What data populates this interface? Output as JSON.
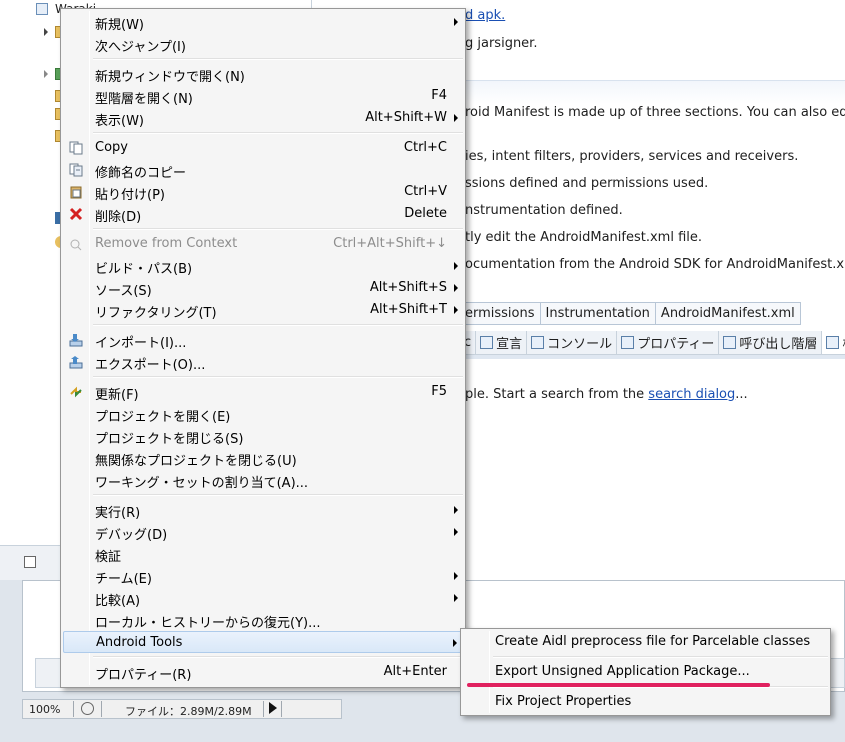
{
  "background": {
    "project_name": "Waraki",
    "editor_lines": [
      {
        "text": "d apk.",
        "link": true
      },
      {
        "text": "g jarsigner.",
        "link": false
      },
      {
        "text": "roid Manifest is made up of three sections. You can also edit the",
        "link": false
      },
      {
        "text": "ies, intent filters, providers, services and receivers.",
        "link": false
      },
      {
        "text": "ssions defined and permissions used.",
        "link": false
      },
      {
        "text": "nstrumentation defined.",
        "link": false
      },
      {
        "text": "tly edit the AndroidManifest.xml file.",
        "link": false
      },
      {
        "text": "ocumentation from the Android SDK for AndroidManifest.xml.",
        "link": false
      }
    ],
    "editor_tabs": [
      "ermissions",
      "Instrumentation",
      "AndroidManifest.xml"
    ],
    "view_tabs": [
      "c",
      "宣言",
      "コンソール",
      "プロパティー",
      "呼び出し階層",
      "検"
    ],
    "search_text": "ple. Start a search from the",
    "search_link": "search dialog",
    "search_tail": "...",
    "status": {
      "zoom": "100%",
      "memory": "ファイル：2.89M/2.89M"
    }
  },
  "menu": {
    "items": [
      {
        "label": "新規(W)",
        "shortcut": "",
        "submenu": true,
        "icon": "",
        "disabled": false
      },
      {
        "label": "次へジャンプ(I)",
        "shortcut": "",
        "submenu": false,
        "icon": "",
        "disabled": false
      },
      {
        "label": "新規ウィンドウで開く(N)",
        "shortcut": "",
        "submenu": false,
        "icon": "",
        "disabled": false
      },
      {
        "label": "型階層を開く(N)",
        "shortcut": "F4",
        "submenu": false,
        "icon": "",
        "disabled": false
      },
      {
        "label": "表示(W)",
        "shortcut": "Alt+Shift+W",
        "submenu": true,
        "icon": "",
        "disabled": false
      },
      {
        "label": "Copy",
        "shortcut": "Ctrl+C",
        "submenu": false,
        "icon": "copy-icon",
        "disabled": false
      },
      {
        "label": "修飾名のコピー",
        "shortcut": "",
        "submenu": false,
        "icon": "copy-qualified-icon",
        "disabled": false
      },
      {
        "label": "貼り付け(P)",
        "shortcut": "Ctrl+V",
        "submenu": false,
        "icon": "paste-icon",
        "disabled": false
      },
      {
        "label": "削除(D)",
        "shortcut": "Delete",
        "submenu": false,
        "icon": "delete-icon",
        "disabled": false
      },
      {
        "label": "Remove from Context",
        "shortcut": "Ctrl+Alt+Shift+↓",
        "submenu": false,
        "icon": "remove-context-icon",
        "disabled": true
      },
      {
        "label": "ビルド・パス(B)",
        "shortcut": "",
        "submenu": true,
        "icon": "",
        "disabled": false
      },
      {
        "label": "ソース(S)",
        "shortcut": "Alt+Shift+S",
        "submenu": true,
        "icon": "",
        "disabled": false
      },
      {
        "label": "リファクタリング(T)",
        "shortcut": "Alt+Shift+T",
        "submenu": true,
        "icon": "",
        "disabled": false
      },
      {
        "label": "インポート(I)...",
        "shortcut": "",
        "submenu": false,
        "icon": "import-icon",
        "disabled": false
      },
      {
        "label": "エクスポート(O)...",
        "shortcut": "",
        "submenu": false,
        "icon": "export-icon",
        "disabled": false
      },
      {
        "label": "更新(F)",
        "shortcut": "F5",
        "submenu": false,
        "icon": "refresh-icon",
        "disabled": false
      },
      {
        "label": "プロジェクトを開く(E)",
        "shortcut": "",
        "submenu": false,
        "icon": "",
        "disabled": false
      },
      {
        "label": "プロジェクトを閉じる(S)",
        "shortcut": "",
        "submenu": false,
        "icon": "",
        "disabled": false
      },
      {
        "label": "無関係なプロジェクトを閉じる(U)",
        "shortcut": "",
        "submenu": false,
        "icon": "",
        "disabled": false
      },
      {
        "label": "ワーキング・セットの割り当て(A)...",
        "shortcut": "",
        "submenu": false,
        "icon": "",
        "disabled": false
      },
      {
        "label": "実行(R)",
        "shortcut": "",
        "submenu": true,
        "icon": "",
        "disabled": false
      },
      {
        "label": "デバッグ(D)",
        "shortcut": "",
        "submenu": true,
        "icon": "",
        "disabled": false
      },
      {
        "label": "検証",
        "shortcut": "",
        "submenu": false,
        "icon": "",
        "disabled": false
      },
      {
        "label": "チーム(E)",
        "shortcut": "",
        "submenu": true,
        "icon": "",
        "disabled": false
      },
      {
        "label": "比較(A)",
        "shortcut": "",
        "submenu": true,
        "icon": "",
        "disabled": false
      },
      {
        "label": "ローカル・ヒストリーからの復元(Y)...",
        "shortcut": "",
        "submenu": false,
        "icon": "",
        "disabled": false
      },
      {
        "label": "Android Tools",
        "shortcut": "",
        "submenu": true,
        "icon": "",
        "disabled": false,
        "highlighted": true
      },
      {
        "label": "プロパティー(R)",
        "shortcut": "Alt+Enter",
        "submenu": false,
        "icon": "",
        "disabled": false
      }
    ]
  },
  "submenu": {
    "items": [
      {
        "label": "Create Aidl preprocess file for Parcelable classes"
      },
      {
        "label": "Export Unsigned Application Package..."
      },
      {
        "label": "Fix Project Properties"
      }
    ],
    "annotation_color": "#e0215f"
  }
}
